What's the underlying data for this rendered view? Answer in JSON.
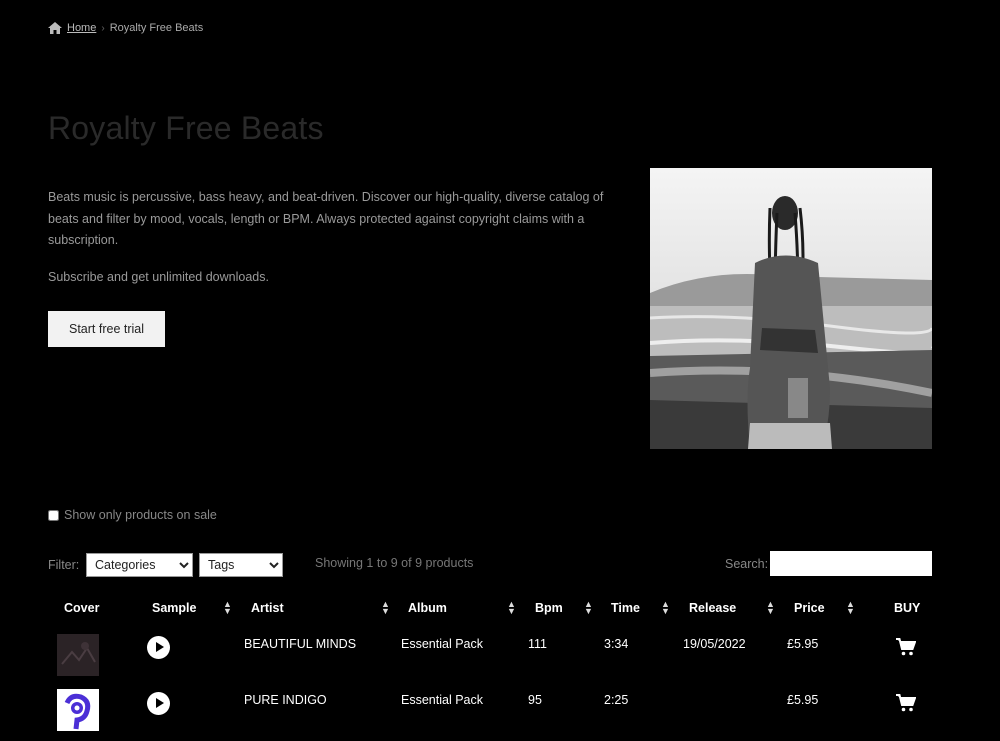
{
  "breadcrumb": {
    "home": "Home",
    "separator": "›",
    "current": "Royalty Free Beats"
  },
  "page": {
    "title": "Royalty Free Beats",
    "description": "Beats music is percussive, bass heavy, and beat-driven. Discover our high-quality, diverse catalog of beats and filter by mood, vocals, length or BPM. Always protected against copyright claims with a subscription.",
    "subscribe_text": "Subscribe and get unlimited downloads.",
    "trial_button": "Start free trial"
  },
  "filters": {
    "sale_checkbox_label": "Show only products on sale",
    "filter_label": "Filter:",
    "categories": "Categories",
    "tags": "Tags",
    "showing": "Showing 1 to 9 of 9 products",
    "search_label": "Search:",
    "search_value": ""
  },
  "table": {
    "headers": [
      "Cover",
      "Sample",
      "Artist",
      "Album",
      "Bpm",
      "Time",
      "Release",
      "Price",
      "BUY"
    ],
    "rows": [
      {
        "artist": "BEAUTIFUL MINDS",
        "album": "Essential Pack",
        "bpm": "111",
        "time": "3:34",
        "release": "19/05/2022",
        "price": "£5.95"
      },
      {
        "artist": "PURE INDIGO",
        "album": "Essential Pack",
        "bpm": "95",
        "time": "2:25",
        "release": "",
        "price": "£5.95"
      }
    ]
  },
  "icons": {
    "home": "home-icon",
    "play": "play-icon",
    "cart": "cart-icon",
    "sort": "sort-arrows-icon"
  },
  "colors": {
    "background": "#000000",
    "text": "#ffffff",
    "button": "#f2f2f2"
  }
}
